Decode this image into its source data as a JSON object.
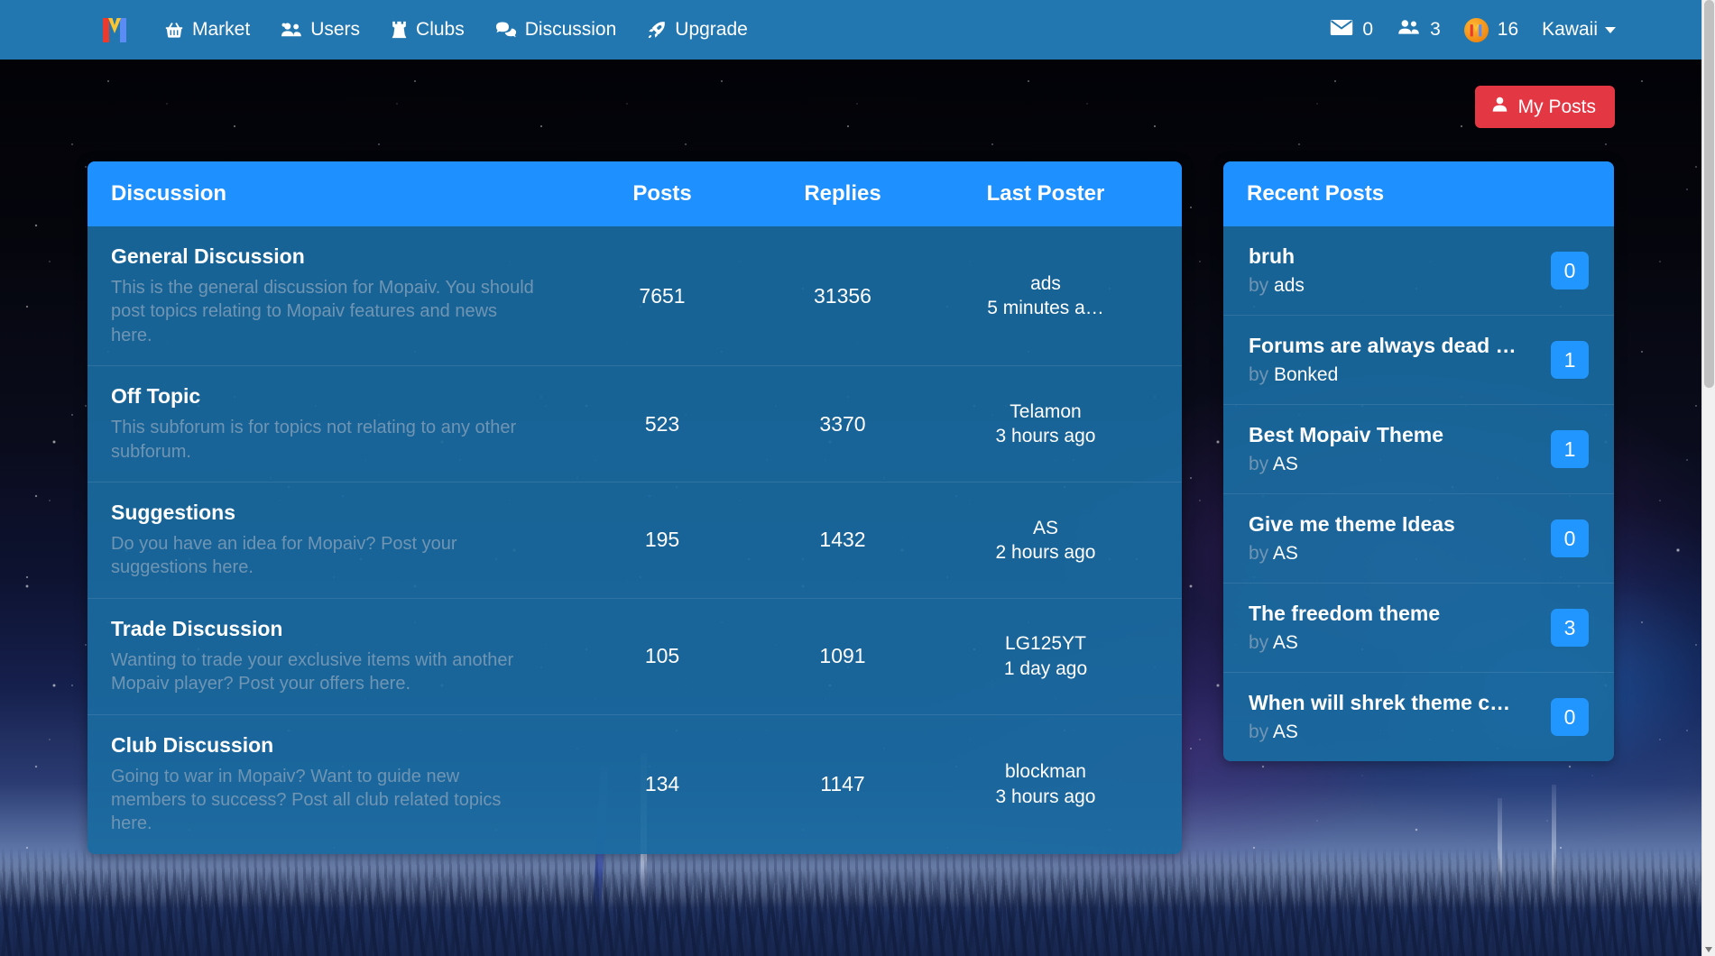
{
  "navbar": {
    "brand_label": "M",
    "items": [
      {
        "label": "Market",
        "icon": "basket-icon"
      },
      {
        "label": "Users",
        "icon": "users-icon"
      },
      {
        "label": "Clubs",
        "icon": "chess-rook-icon"
      },
      {
        "label": "Discussion",
        "icon": "comments-icon"
      },
      {
        "label": "Upgrade",
        "icon": "rocket-icon"
      }
    ],
    "stats": {
      "messages_count": "0",
      "friends_count": "3",
      "coins_count": "16"
    },
    "username": "Kawaii"
  },
  "actions": {
    "my_posts_label": "My Posts"
  },
  "discussion_panel": {
    "columns": {
      "discussion": "Discussion",
      "posts": "Posts",
      "replies": "Replies",
      "last_poster": "Last Poster"
    },
    "rows": [
      {
        "title": "General Discussion",
        "description": "This is the general discussion for Mopaiv. You should post topics relating to Mopaiv features and news here.",
        "posts": "7651",
        "replies": "31356",
        "last_poster": "ads",
        "last_time": "5 minutes a…"
      },
      {
        "title": "Off Topic",
        "description": "This subforum is for topics not relating to any other subforum.",
        "posts": "523",
        "replies": "3370",
        "last_poster": "Telamon",
        "last_time": "3 hours ago"
      },
      {
        "title": "Suggestions",
        "description": "Do you have an idea for Mopaiv? Post your suggestions here.",
        "posts": "195",
        "replies": "1432",
        "last_poster": "AS",
        "last_time": "2 hours ago"
      },
      {
        "title": "Trade Discussion",
        "description": "Wanting to trade your exclusive items with another Mopaiv player? Post your offers here.",
        "posts": "105",
        "replies": "1091",
        "last_poster": "LG125YT",
        "last_time": "1 day ago"
      },
      {
        "title": "Club Discussion",
        "description": "Going to war in Mopaiv? Want to guide new members to success? Post all club related topics here.",
        "posts": "134",
        "replies": "1147",
        "last_poster": "blockman",
        "last_time": "3 hours ago"
      }
    ]
  },
  "recent_posts_panel": {
    "title": "Recent Posts",
    "by_label": "by",
    "rows": [
      {
        "title": "bruh",
        "author": "ads",
        "count": "0"
      },
      {
        "title": "Forums are always dead …",
        "author": "Bonked",
        "count": "1"
      },
      {
        "title": "Best Mopaiv Theme",
        "author": "AS",
        "count": "1"
      },
      {
        "title": "Give me theme Ideas",
        "author": "AS",
        "count": "0"
      },
      {
        "title": "The freedom theme",
        "author": "AS",
        "count": "3"
      },
      {
        "title": "When will shrek theme c…",
        "author": "AS",
        "count": "0"
      }
    ]
  },
  "colors": {
    "navbar_bg": "#2277b0",
    "panel_bg": "#1a6aa0",
    "panel_header": "#1f90ff",
    "accent_red": "#e43744",
    "badge_blue": "#2196ff",
    "muted_text": "#6f95b3"
  }
}
